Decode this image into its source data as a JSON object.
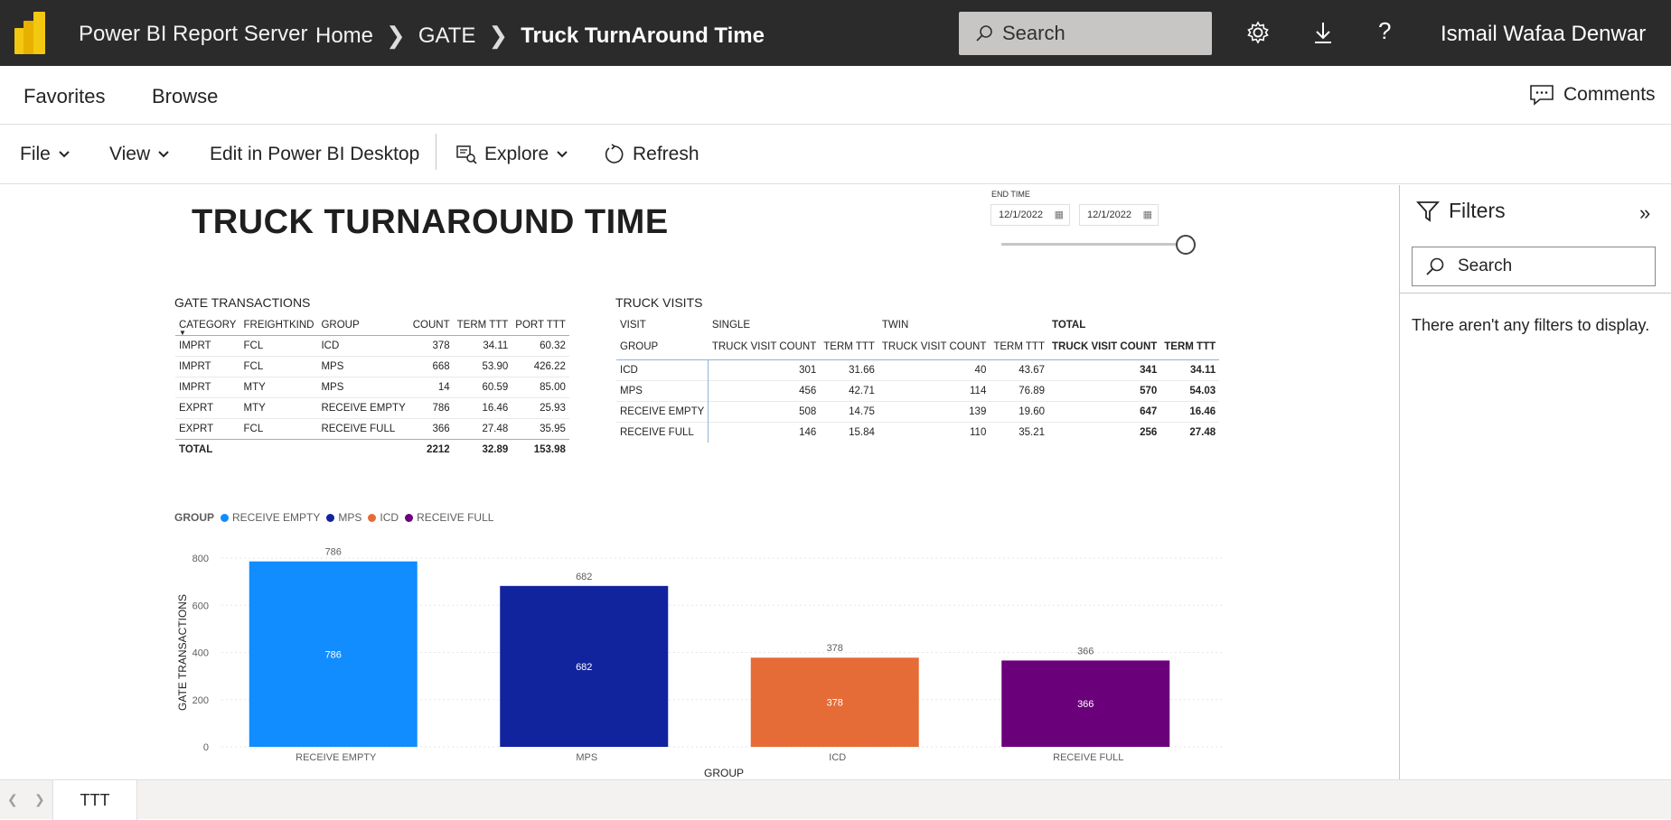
{
  "topbar": {
    "app_title": "Power BI Report Server",
    "breadcrumbs": [
      "Home",
      "GATE",
      "Truck TurnAround Time"
    ],
    "search_placeholder": "Search",
    "user_name": "Ismail Wafaa Denwar",
    "icons": [
      "settings-icon",
      "download-icon",
      "help-icon"
    ]
  },
  "nav": {
    "favorites": "Favorites",
    "browse": "Browse",
    "comments": "Comments"
  },
  "toolbar": {
    "file": "File",
    "view": "View",
    "edit": "Edit in Power BI Desktop",
    "explore": "Explore",
    "refresh": "Refresh"
  },
  "report": {
    "title": "TRUCK TURNAROUND TIME",
    "slicer": {
      "label": "END TIME",
      "start": "12/1/2022",
      "end": "12/1/2022"
    },
    "gate": {
      "title": "GATE TRANSACTIONS",
      "headers": [
        "CATEGORY",
        "FREIGHTKIND",
        "GROUP",
        "COUNT",
        "TERM TTT",
        "PORT TTT"
      ],
      "rows": [
        [
          "IMPRT",
          "FCL",
          "ICD",
          "378",
          "34.11",
          "60.32"
        ],
        [
          "IMPRT",
          "FCL",
          "MPS",
          "668",
          "53.90",
          "426.22"
        ],
        [
          "IMPRT",
          "MTY",
          "MPS",
          "14",
          "60.59",
          "85.00"
        ],
        [
          "EXPRT",
          "MTY",
          "RECEIVE EMPTY",
          "786",
          "16.46",
          "25.93"
        ],
        [
          "EXPRT",
          "FCL",
          "RECEIVE FULL",
          "366",
          "27.48",
          "35.95"
        ]
      ],
      "total": [
        "TOTAL",
        "",
        "",
        "2212",
        "32.89",
        "153.98"
      ]
    },
    "truck": {
      "title": "TRUCK VISITS",
      "top_headers": [
        "VISIT",
        "SINGLE",
        "",
        "TWIN",
        "",
        "TOTAL",
        ""
      ],
      "sub_headers": [
        "GROUP",
        "TRUCK VISIT COUNT",
        "TERM TTT",
        "TRUCK VISIT COUNT",
        "TERM TTT",
        "TRUCK VISIT COUNT",
        "TERM TTT"
      ],
      "rows": [
        [
          "ICD",
          "301",
          "31.66",
          "40",
          "43.67",
          "341",
          "34.11"
        ],
        [
          "MPS",
          "456",
          "42.71",
          "114",
          "76.89",
          "570",
          "54.03"
        ],
        [
          "RECEIVE EMPTY",
          "508",
          "14.75",
          "139",
          "19.60",
          "647",
          "16.46"
        ],
        [
          "RECEIVE FULL",
          "146",
          "15.84",
          "110",
          "35.21",
          "256",
          "27.48"
        ]
      ]
    },
    "legend": {
      "title": "GROUP",
      "items": [
        {
          "label": "RECEIVE EMPTY",
          "color": "#118dff"
        },
        {
          "label": "MPS",
          "color": "#12239e"
        },
        {
          "label": "ICD",
          "color": "#e66c37"
        },
        {
          "label": "RECEIVE FULL",
          "color": "#6b007b"
        }
      ]
    }
  },
  "chart_data": {
    "type": "bar",
    "categories": [
      "RECEIVE EMPTY",
      "MPS",
      "ICD",
      "RECEIVE FULL"
    ],
    "values": [
      786,
      682,
      378,
      366
    ],
    "colors": [
      "#118dff",
      "#12239e",
      "#e66c37",
      "#6b007b"
    ],
    "xlabel": "GROUP",
    "ylabel": "GATE TRANSACTIONS",
    "ylim": [
      0,
      800
    ],
    "yticks": [
      0,
      200,
      400,
      600,
      800
    ],
    "grid": true
  },
  "filters": {
    "title": "Filters",
    "search_placeholder": "Search",
    "empty": "There aren't any filters to display."
  },
  "tabs": {
    "active": "TTT"
  }
}
